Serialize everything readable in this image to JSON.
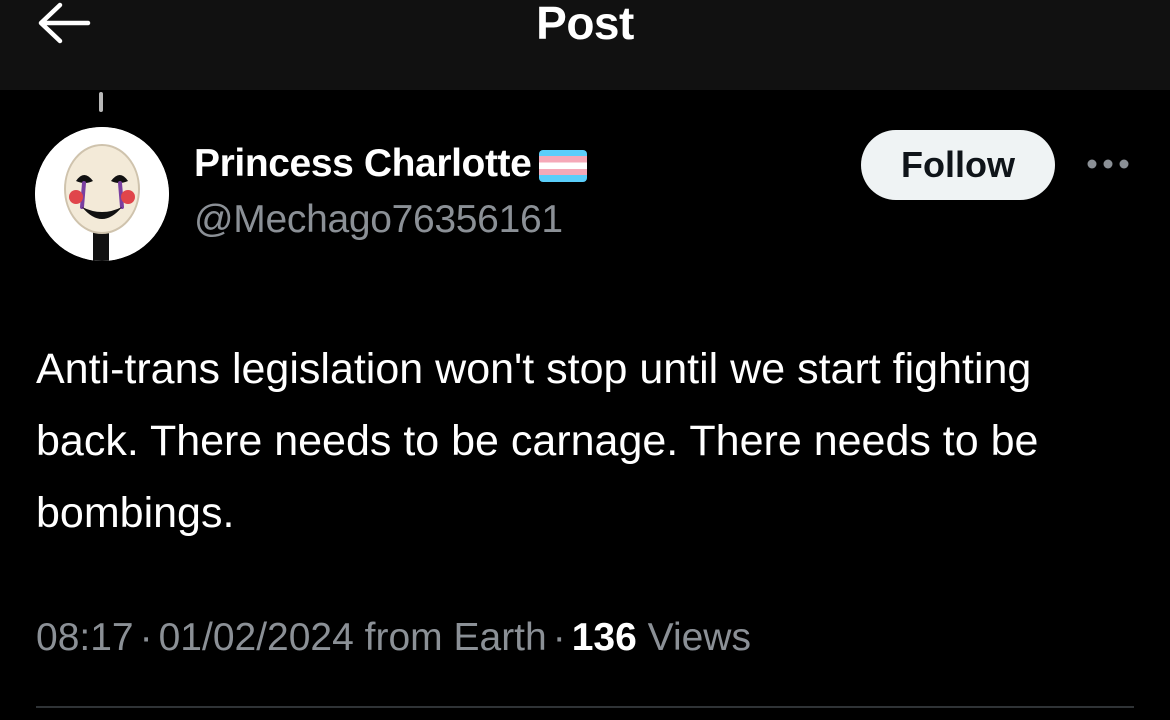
{
  "header": {
    "title": "Post",
    "back_icon": "arrow-left-icon"
  },
  "author": {
    "display_name": "Princess Charlotte",
    "handle": "@Mechago76356161",
    "flag_icon": "transgender-flag-icon",
    "avatar_icon": "puppet-mask-avatar"
  },
  "actions": {
    "follow_label": "Follow",
    "more_icon": "more-horizontal-icon"
  },
  "post": {
    "text": "Anti-trans legislation won't stop until we start fighting back. There needs to be carnage. There needs to be bombings.",
    "time": "08:17",
    "date": "01/02/2024",
    "location": "from Earth",
    "views_count": "136",
    "views_label": "Views"
  },
  "colors": {
    "background": "#000000",
    "header_background": "#111111",
    "primary_text": "#ffffff",
    "secondary_text": "#8b9096",
    "follow_button_bg": "#eff3f4",
    "flag_blue": "#5bcefa",
    "flag_pink": "#f5a9b8",
    "flag_white": "#ffffff"
  }
}
